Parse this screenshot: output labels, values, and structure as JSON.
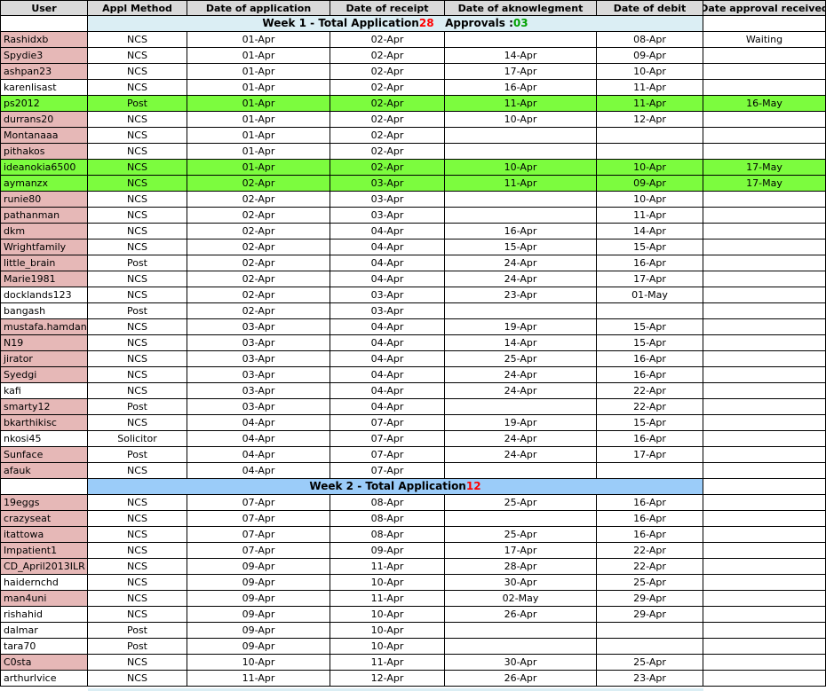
{
  "headers": [
    "User",
    "Appl Method",
    "Date of application",
    "Date of receipt",
    "Date of aknowlegment",
    "Date of debit",
    "Date approval received"
  ],
  "week1": {
    "label": "Week 1 - Total Application ",
    "total": "28",
    "approvals_label": "Approvals : ",
    "approvals": "03"
  },
  "week2": {
    "label": "Week 2 - Total Application ",
    "total": "12"
  },
  "week1_rows": [
    {
      "user": "Rashidxb",
      "method": "NCS",
      "applied": "01-Apr",
      "receipt": "02-Apr",
      "ack": "",
      "debit": "08-Apr",
      "approval": "Waiting",
      "user_pink": true,
      "approved": false
    },
    {
      "user": "Spydie3",
      "method": "NCS",
      "applied": "01-Apr",
      "receipt": "02-Apr",
      "ack": "14-Apr",
      "debit": "09-Apr",
      "approval": "",
      "user_pink": true,
      "approved": false
    },
    {
      "user": "ashpan23",
      "method": "NCS",
      "applied": "01-Apr",
      "receipt": "02-Apr",
      "ack": "17-Apr",
      "debit": "10-Apr",
      "approval": "",
      "user_pink": true,
      "approved": false
    },
    {
      "user": "karenlisast",
      "method": "NCS",
      "applied": "01-Apr",
      "receipt": "02-Apr",
      "ack": "16-Apr",
      "debit": "11-Apr",
      "approval": "",
      "user_pink": false,
      "approved": false
    },
    {
      "user": "ps2012",
      "method": "Post",
      "applied": "01-Apr",
      "receipt": "02-Apr",
      "ack": "11-Apr",
      "debit": "11-Apr",
      "approval": "16-May",
      "user_pink": false,
      "approved": true
    },
    {
      "user": "durrans20",
      "method": "NCS",
      "applied": "01-Apr",
      "receipt": "02-Apr",
      "ack": "10-Apr",
      "debit": "12-Apr",
      "approval": "",
      "user_pink": true,
      "approved": false
    },
    {
      "user": "Montanaaa",
      "method": "NCS",
      "applied": "01-Apr",
      "receipt": "02-Apr",
      "ack": "",
      "debit": "",
      "approval": "",
      "user_pink": true,
      "approved": false
    },
    {
      "user": "pithakos",
      "method": "NCS",
      "applied": "01-Apr",
      "receipt": "02-Apr",
      "ack": "",
      "debit": "",
      "approval": "",
      "user_pink": true,
      "approved": false
    },
    {
      "user": "ideanokia6500",
      "method": "NCS",
      "applied": "01-Apr",
      "receipt": "02-Apr",
      "ack": "10-Apr",
      "debit": "10-Apr",
      "approval": "17-May",
      "user_pink": false,
      "approved": true
    },
    {
      "user": "aymanzx",
      "method": "NCS",
      "applied": "02-Apr",
      "receipt": "03-Apr",
      "ack": "11-Apr",
      "debit": "09-Apr",
      "approval": "17-May",
      "user_pink": false,
      "approved": true
    },
    {
      "user": "runie80",
      "method": "NCS",
      "applied": "02-Apr",
      "receipt": "03-Apr",
      "ack": "",
      "debit": "10-Apr",
      "approval": "",
      "user_pink": true,
      "approved": false
    },
    {
      "user": "pathanman",
      "method": "NCS",
      "applied": "02-Apr",
      "receipt": "03-Apr",
      "ack": "",
      "debit": "11-Apr",
      "approval": "",
      "user_pink": true,
      "approved": false
    },
    {
      "user": "dkm",
      "method": "NCS",
      "applied": "02-Apr",
      "receipt": "04-Apr",
      "ack": "16-Apr",
      "debit": "14-Apr",
      "approval": "",
      "user_pink": true,
      "approved": false
    },
    {
      "user": "Wrightfamily",
      "method": "NCS",
      "applied": "02-Apr",
      "receipt": "04-Apr",
      "ack": "15-Apr",
      "debit": "15-Apr",
      "approval": "",
      "user_pink": true,
      "approved": false
    },
    {
      "user": "little_brain",
      "method": "Post",
      "applied": "02-Apr",
      "receipt": "04-Apr",
      "ack": "24-Apr",
      "debit": "16-Apr",
      "approval": "",
      "user_pink": true,
      "approved": false
    },
    {
      "user": "Marie1981",
      "method": "NCS",
      "applied": "02-Apr",
      "receipt": "04-Apr",
      "ack": "24-Apr",
      "debit": "17-Apr",
      "approval": "",
      "user_pink": true,
      "approved": false
    },
    {
      "user": "docklands123",
      "method": "NCS",
      "applied": "02-Apr",
      "receipt": "03-Apr",
      "ack": "23-Apr",
      "debit": "01-May",
      "approval": "",
      "user_pink": false,
      "approved": false
    },
    {
      "user": "bangash",
      "method": "Post",
      "applied": "02-Apr",
      "receipt": "03-Apr",
      "ack": "",
      "debit": "",
      "approval": "",
      "user_pink": false,
      "approved": false
    },
    {
      "user": "mustafa.hamdan",
      "method": "NCS",
      "applied": "03-Apr",
      "receipt": "04-Apr",
      "ack": "19-Apr",
      "debit": "15-Apr",
      "approval": "",
      "user_pink": true,
      "approved": false
    },
    {
      "user": "N19",
      "method": "NCS",
      "applied": "03-Apr",
      "receipt": "04-Apr",
      "ack": "14-Apr",
      "debit": "15-Apr",
      "approval": "",
      "user_pink": true,
      "approved": false
    },
    {
      "user": "jirator",
      "method": "NCS",
      "applied": "03-Apr",
      "receipt": "04-Apr",
      "ack": "25-Apr",
      "debit": "16-Apr",
      "approval": "",
      "user_pink": true,
      "approved": false
    },
    {
      "user": "Syedgi",
      "method": "NCS",
      "applied": "03-Apr",
      "receipt": "04-Apr",
      "ack": "24-Apr",
      "debit": "16-Apr",
      "approval": "",
      "user_pink": true,
      "approved": false
    },
    {
      "user": "kafi",
      "method": "NCS",
      "applied": "03-Apr",
      "receipt": "04-Apr",
      "ack": "24-Apr",
      "debit": "22-Apr",
      "approval": "",
      "user_pink": false,
      "approved": false
    },
    {
      "user": "smarty12",
      "method": "Post",
      "applied": "03-Apr",
      "receipt": "04-Apr",
      "ack": "",
      "debit": "22-Apr",
      "approval": "",
      "user_pink": true,
      "approved": false
    },
    {
      "user": "bkarthikisc",
      "method": "NCS",
      "applied": "04-Apr",
      "receipt": "07-Apr",
      "ack": "19-Apr",
      "debit": "15-Apr",
      "approval": "",
      "user_pink": true,
      "approved": false
    },
    {
      "user": "nkosi45",
      "method": "Solicitor",
      "applied": "04-Apr",
      "receipt": "07-Apr",
      "ack": "24-Apr",
      "debit": "16-Apr",
      "approval": "",
      "user_pink": false,
      "approved": false
    },
    {
      "user": "Sunface",
      "method": "Post",
      "applied": "04-Apr",
      "receipt": "07-Apr",
      "ack": "24-Apr",
      "debit": "17-Apr",
      "approval": "",
      "user_pink": true,
      "approved": false
    },
    {
      "user": "afauk",
      "method": "NCS",
      "applied": "04-Apr",
      "receipt": "07-Apr",
      "ack": "",
      "debit": "",
      "approval": "",
      "user_pink": true,
      "approved": false
    }
  ],
  "week2_rows": [
    {
      "user": "19eggs",
      "method": "NCS",
      "applied": "07-Apr",
      "receipt": "08-Apr",
      "ack": "25-Apr",
      "debit": "16-Apr",
      "approval": "",
      "user_pink": true,
      "approved": false
    },
    {
      "user": "crazyseat",
      "method": "NCS",
      "applied": "07-Apr",
      "receipt": "08-Apr",
      "ack": "",
      "debit": "16-Apr",
      "approval": "",
      "user_pink": true,
      "approved": false
    },
    {
      "user": "itattowa",
      "method": "NCS",
      "applied": "07-Apr",
      "receipt": "08-Apr",
      "ack": "25-Apr",
      "debit": "16-Apr",
      "approval": "",
      "user_pink": true,
      "approved": false
    },
    {
      "user": "Impatient1",
      "method": "NCS",
      "applied": "07-Apr",
      "receipt": "09-Apr",
      "ack": "17-Apr",
      "debit": "22-Apr",
      "approval": "",
      "user_pink": true,
      "approved": false
    },
    {
      "user": "CD_April2013ILR",
      "method": "NCS",
      "applied": "09-Apr",
      "receipt": "11-Apr",
      "ack": "28-Apr",
      "debit": "22-Apr",
      "approval": "",
      "user_pink": true,
      "approved": false
    },
    {
      "user": "haidernchd",
      "method": "NCS",
      "applied": "09-Apr",
      "receipt": "10-Apr",
      "ack": "30-Apr",
      "debit": "25-Apr",
      "approval": "",
      "user_pink": false,
      "approved": false
    },
    {
      "user": "man4uni",
      "method": "NCS",
      "applied": "09-Apr",
      "receipt": "11-Apr",
      "ack": "02-May",
      "debit": "29-Apr",
      "approval": "",
      "user_pink": true,
      "approved": false
    },
    {
      "user": "rishahid",
      "method": "NCS",
      "applied": "09-Apr",
      "receipt": "10-Apr",
      "ack": "26-Apr",
      "debit": "29-Apr",
      "approval": "",
      "user_pink": false,
      "approved": false
    },
    {
      "user": "dalmar",
      "method": "Post",
      "applied": "09-Apr",
      "receipt": "10-Apr",
      "ack": "",
      "debit": "",
      "approval": "",
      "user_pink": false,
      "approved": false
    },
    {
      "user": "tara70",
      "method": "Post",
      "applied": "09-Apr",
      "receipt": "10-Apr",
      "ack": "",
      "debit": "",
      "approval": "",
      "user_pink": false,
      "approved": false
    },
    {
      "user": "C0sta",
      "method": "NCS",
      "applied": "10-Apr",
      "receipt": "11-Apr",
      "ack": "30-Apr",
      "debit": "25-Apr",
      "approval": "",
      "user_pink": true,
      "approved": false
    },
    {
      "user": "arthurlvice",
      "method": "NCS",
      "applied": "11-Apr",
      "receipt": "12-Apr",
      "ack": "26-Apr",
      "debit": "23-Apr",
      "approval": "",
      "user_pink": false,
      "approved": false
    }
  ],
  "colors": {
    "header_bg": "#d9d9d9",
    "user_pink": "#e6b8b7",
    "approved_green": "#7cfc3e",
    "week1_band": "#dbeef4",
    "week2_band": "#9bccf9",
    "total_red": "#ff0000",
    "approvals_green": "#00a000"
  }
}
